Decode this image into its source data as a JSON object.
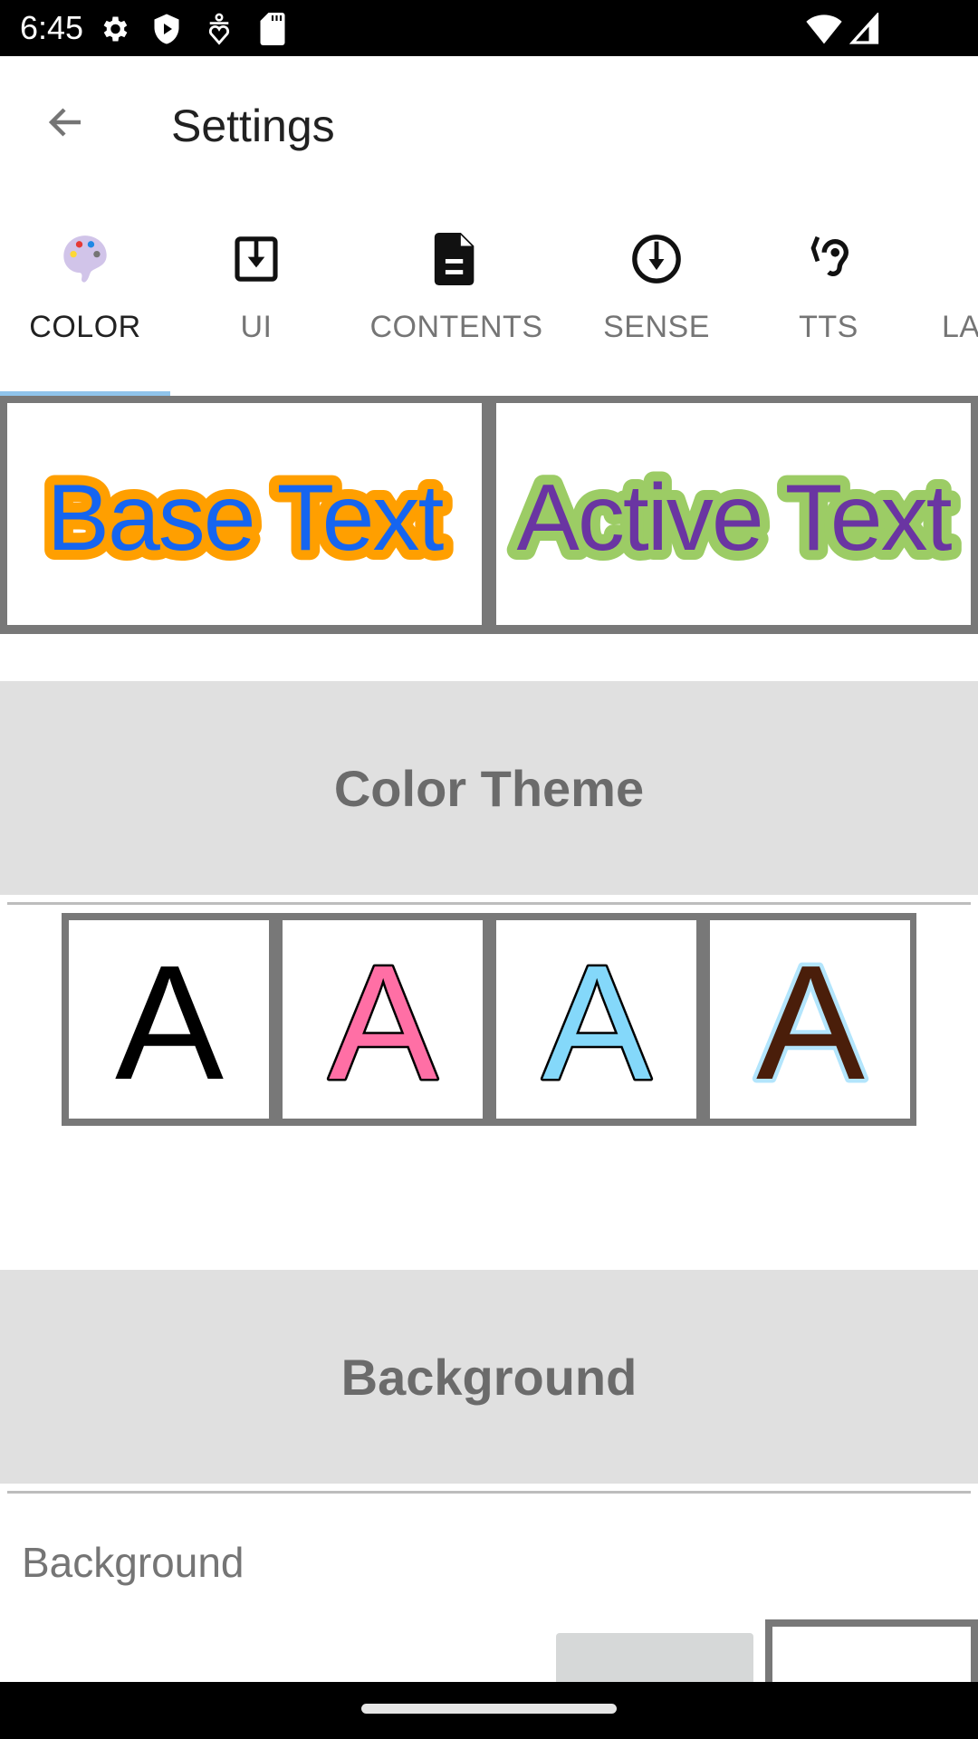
{
  "status_bar": {
    "time": "6:45",
    "left_icons": [
      "settings-gear-icon",
      "shield-play-icon",
      "accessibility-person-icon",
      "sd-card-icon"
    ],
    "right_icons": [
      "wifi-icon",
      "cellular-signal-icon"
    ]
  },
  "app_bar": {
    "back_icon": "arrow-back-icon",
    "title": "Settings"
  },
  "tabs": [
    {
      "label": "COLOR",
      "icon": "palette-icon",
      "active": true
    },
    {
      "label": "UI",
      "icon": "download-box-icon",
      "active": false
    },
    {
      "label": "CONTENTS",
      "icon": "document-icon",
      "active": false
    },
    {
      "label": "SENSE",
      "icon": "download-circle-icon",
      "active": false
    },
    {
      "label": "TTS",
      "icon": "hearing-icon",
      "active": false
    },
    {
      "label": "LA",
      "icon": "",
      "active": false
    }
  ],
  "preview": {
    "base": {
      "label": "Base Text",
      "fill": "#1565f0",
      "stroke": "#ff9f00"
    },
    "active": {
      "label": "Active Text",
      "fill": "#6a35a2",
      "stroke": "#9ccc65"
    }
  },
  "sections": {
    "color_theme": "Color Theme",
    "background": "Background"
  },
  "color_themes": [
    {
      "glyph": "A",
      "fill": "#000000",
      "stroke": "none"
    },
    {
      "glyph": "A",
      "fill": "#ff6fa5",
      "stroke": "#000000"
    },
    {
      "glyph": "A",
      "fill": "#84d8fa",
      "stroke": "#000000"
    },
    {
      "glyph": "A",
      "fill": "#4a1e0a",
      "stroke": "#b3e5fc"
    }
  ],
  "background": {
    "label": "Background",
    "swatches": [
      "#d6d8d8",
      "#ffffff"
    ]
  },
  "colors": {
    "tab_indicator": "#90c4ec",
    "section_header_bg": "#e0e0e0",
    "border_gray": "#787878"
  }
}
